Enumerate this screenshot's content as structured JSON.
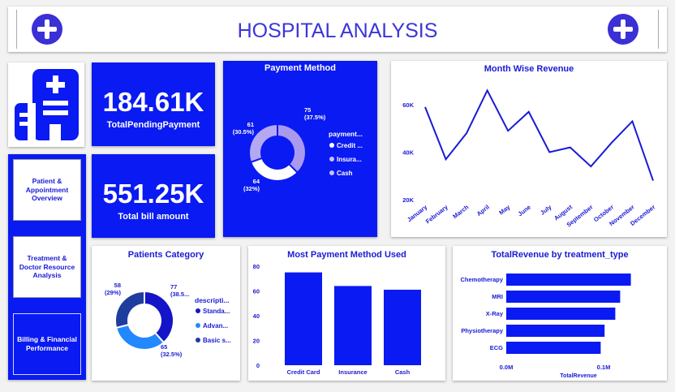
{
  "header": {
    "title": "HOSPITAL ANALYSIS"
  },
  "icons": {
    "left_plus": "plus-circle-icon",
    "right_plus": "plus-circle-icon",
    "logo": "hospital-building-icon"
  },
  "colors": {
    "brand_blue": "#0a1af2",
    "chart_blue": "#1a1ad6",
    "light_purple": "#a99af0",
    "donut_dark": "#1f3d9e",
    "donut_light": "#2288ff"
  },
  "nav": {
    "items": [
      {
        "label": "Patient & Appointment Overview"
      },
      {
        "label": "Treatment & Doctor Resource Analysis"
      },
      {
        "label": "Billing & Financial Performance"
      }
    ]
  },
  "kpi": {
    "pending": {
      "value": "184.61K",
      "label": "TotalPendingPayment"
    },
    "bill": {
      "value": "551.25K",
      "label": "Total bill amount"
    }
  },
  "payment_method": {
    "title": "Payment Method",
    "legend_title": "payment...",
    "legend": [
      "Credit ...",
      "Insura...",
      "Cash"
    ],
    "labels": [
      {
        "count": "75",
        "pct": "(37.5%)"
      },
      {
        "count": "64",
        "pct": "(32%)"
      },
      {
        "count": "61",
        "pct": "(30.5%)"
      }
    ]
  },
  "month_revenue": {
    "title": "Month Wise Revenue",
    "y_ticks": [
      "60K",
      "40K",
      "20K"
    ]
  },
  "patients_category": {
    "title": "Patients Category",
    "legend_title": "descripti...",
    "legend": [
      "Standa...",
      "Advan...",
      "Basic s..."
    ],
    "labels": [
      {
        "count": "77",
        "pct": "(38.5...",
        "pos": "tr"
      },
      {
        "count": "65",
        "pct": "(32.5%)",
        "pos": "br"
      },
      {
        "count": "58",
        "pct": "(29%)",
        "pos": "tl"
      }
    ]
  },
  "most_payment": {
    "title": "Most Payment Method Used",
    "y_ticks": [
      "80",
      "60",
      "40",
      "20",
      "0"
    ]
  },
  "treatment_revenue": {
    "title": "TotalRevenue by treatment_type",
    "x_ticks": [
      "0.0M",
      "0.1M"
    ],
    "xlabel": "TotalRevenue"
  },
  "chart_data": [
    {
      "type": "pie",
      "title": "Payment Method",
      "categories": [
        "Credit Card",
        "Insurance",
        "Cash"
      ],
      "values": [
        75,
        64,
        61
      ],
      "percents": [
        37.5,
        32,
        30.5
      ]
    },
    {
      "type": "line",
      "title": "Month Wise Revenue",
      "categories": [
        "January",
        "February",
        "March",
        "April",
        "May",
        "June",
        "July",
        "August",
        "September",
        "October",
        "November",
        "December"
      ],
      "values": [
        59000,
        37000,
        48000,
        66000,
        49000,
        57000,
        40000,
        42000,
        34000,
        44000,
        53000,
        28000
      ],
      "ylim": [
        20000,
        70000
      ]
    },
    {
      "type": "pie",
      "title": "Patients Category",
      "categories": [
        "Standard",
        "Advanced",
        "Basic screening"
      ],
      "values": [
        77,
        65,
        58
      ],
      "percents": [
        38.5,
        32.5,
        29
      ]
    },
    {
      "type": "bar",
      "title": "Most Payment Method Used",
      "categories": [
        "Credit Card",
        "Insurance",
        "Cash"
      ],
      "values": [
        75,
        64,
        61
      ],
      "ylim": [
        0,
        80
      ]
    },
    {
      "type": "bar",
      "orientation": "horizontal",
      "title": "TotalRevenue by treatment_type",
      "categories": [
        "Chemotherapy",
        "MRI",
        "X-Ray",
        "Physiotherapy",
        "ECG"
      ],
      "values": [
        0.128,
        0.117,
        0.112,
        0.101,
        0.097
      ],
      "xlabel": "TotalRevenue",
      "xlim": [
        0,
        0.14
      ]
    }
  ]
}
